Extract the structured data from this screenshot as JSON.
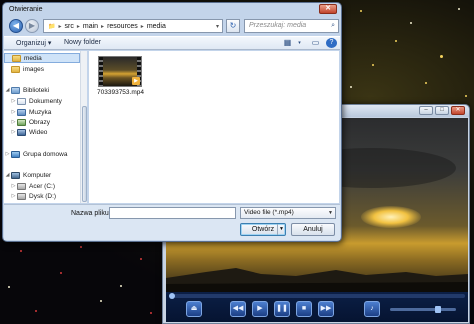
{
  "dialog": {
    "title": "Otwieranie",
    "path": [
      "src",
      "main",
      "resources",
      "media"
    ],
    "search_placeholder": "Przeszukaj: media",
    "organize_label": "Organizuj ▾",
    "new_folder_label": "Nowy folder",
    "nav_items": [
      {
        "label": "media",
        "icon": "folder-icon",
        "selected": true
      },
      {
        "label": "images",
        "icon": "folder-icon",
        "selected": false
      },
      {
        "label": "Biblioteki",
        "icon": "libraries-icon",
        "selected": false
      },
      {
        "label": "Dokumenty",
        "icon": "documents-icon",
        "selected": false
      },
      {
        "label": "Muzyka",
        "icon": "music-icon",
        "selected": false
      },
      {
        "label": "Obrazy",
        "icon": "pictures-icon",
        "selected": false
      },
      {
        "label": "Wideo",
        "icon": "video-icon",
        "selected": false
      },
      {
        "label": "Grupa domowa",
        "icon": "homegroup-icon",
        "selected": false
      },
      {
        "label": "Komputer",
        "icon": "computer-icon",
        "selected": false
      },
      {
        "label": "Acer (C:)",
        "icon": "drive-icon",
        "selected": false
      },
      {
        "label": "Dysk (D:)",
        "icon": "drive-icon",
        "selected": false
      }
    ],
    "files": [
      {
        "name": "703393753.mp4",
        "icon": "video-thumbnail-icon"
      }
    ],
    "filename_label": "Nazwa pliku:",
    "filename_value": "",
    "filetype_value": "Video file (*.mp4)",
    "open_label": "Otwórz",
    "cancel_label": "Anuluj"
  },
  "player": {
    "seek_progress": 0,
    "volume": 0.75,
    "controls": [
      "eject-icon",
      "rewind-icon",
      "play-icon",
      "pause-icon",
      "stop-icon",
      "forward-icon",
      "mute-icon"
    ]
  }
}
